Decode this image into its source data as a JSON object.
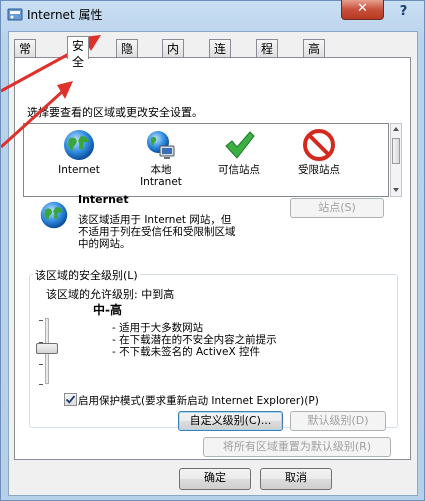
{
  "window": {
    "title": "Internet 属性",
    "close_glyph": "✕",
    "help_glyph": "?"
  },
  "tabs": [
    {
      "label": "常规"
    },
    {
      "label": "安全"
    },
    {
      "label": "隐私"
    },
    {
      "label": "内容"
    },
    {
      "label": "连接"
    },
    {
      "label": "程序"
    },
    {
      "label": "高级"
    }
  ],
  "security": {
    "select_zone_label": "选择要查看的区域或更改安全设置。",
    "zones": [
      {
        "name": "Internet",
        "icon": "globe-icon"
      },
      {
        "name_line1": "本地",
        "name_line2": "Intranet",
        "icon": "local-intranet-icon"
      },
      {
        "name": "可信站点",
        "icon": "check-mark-icon"
      },
      {
        "name": "受限站点",
        "icon": "restricted-icon"
      }
    ],
    "selected_zone": {
      "title": "Internet",
      "description_lines": [
        "该区域适用于 Internet 网站，但",
        "不适用于列在受信任和受限制区域",
        "中的网站。"
      ]
    },
    "sites_button": "站点(S)",
    "level_group_label": "该区域的安全级别(L)",
    "allowed_levels": "该区域的允许级别: 中到高",
    "level_name": "中-高",
    "level_bullets": [
      "- 适用于大多数网站",
      "- 在下载潜在的不安全内容之前提示",
      "- 不下载未签名的 ActiveX 控件"
    ],
    "protected_mode_label": "启用保护模式(要求重新启动 Internet Explorer)(P)",
    "protected_mode_checked": true,
    "custom_level_button": "自定义级别(C)...",
    "default_level_button": "默认级别(D)",
    "reset_all_button": "将所有区域重置为默认级别(R)"
  },
  "footer": {
    "ok": "确定",
    "cancel": "取消"
  },
  "colors": {
    "annotation_arrow": "#e0302a",
    "accent": "#3c7fb1"
  }
}
